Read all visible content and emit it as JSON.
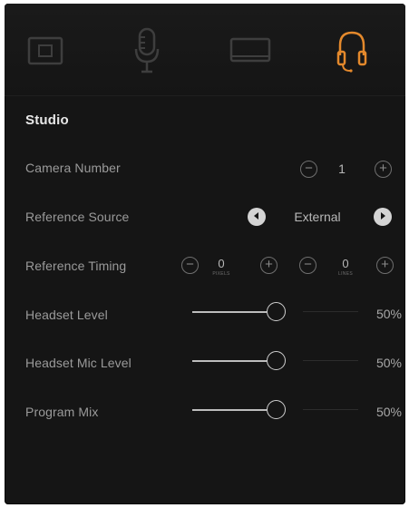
{
  "tabs": [
    {
      "icon": "camera-settings-icon",
      "active": false
    },
    {
      "icon": "microphone-icon",
      "active": false
    },
    {
      "icon": "monitor-icon",
      "active": false
    },
    {
      "icon": "headset-icon",
      "active": true
    }
  ],
  "colors": {
    "background": "#151515",
    "accent": "#e4892c",
    "icon_inactive": "#3e3e3e",
    "label": "#9a9a9a",
    "value": "#b8b8b8"
  },
  "section": {
    "title": "Studio"
  },
  "camera_number": {
    "label": "Camera Number",
    "value": "1",
    "decrement_icon": "minus-circle-icon",
    "increment_icon": "plus-circle-icon"
  },
  "reference_source": {
    "label": "Reference Source",
    "value": "External",
    "prev_icon": "arrow-left-circle-icon",
    "next_icon": "arrow-right-circle-icon"
  },
  "reference_timing": {
    "label": "Reference Timing",
    "pixels": {
      "value": "0",
      "unit": "PIXELS"
    },
    "lines": {
      "value": "0",
      "unit": "LINES"
    }
  },
  "headset_level": {
    "label": "Headset Level",
    "value": "50%",
    "level": 0.5
  },
  "headset_mic_level": {
    "label": "Headset Mic Level",
    "value": "50%",
    "level": 0.5
  },
  "program_mix": {
    "label": "Program Mix",
    "value": "50%",
    "level": 0.5
  }
}
